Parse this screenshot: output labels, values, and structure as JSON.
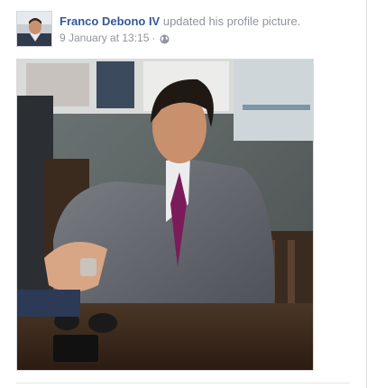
{
  "post": {
    "author": "Franco Debono IV",
    "action": " updated his profile picture.",
    "timestamp": "9 January at 13:15",
    "separator": "·",
    "privacy_icon": "globe-icon"
  },
  "colors": {
    "link": "#365899",
    "meta_text": "#90949c",
    "border": "#dddfe2"
  }
}
